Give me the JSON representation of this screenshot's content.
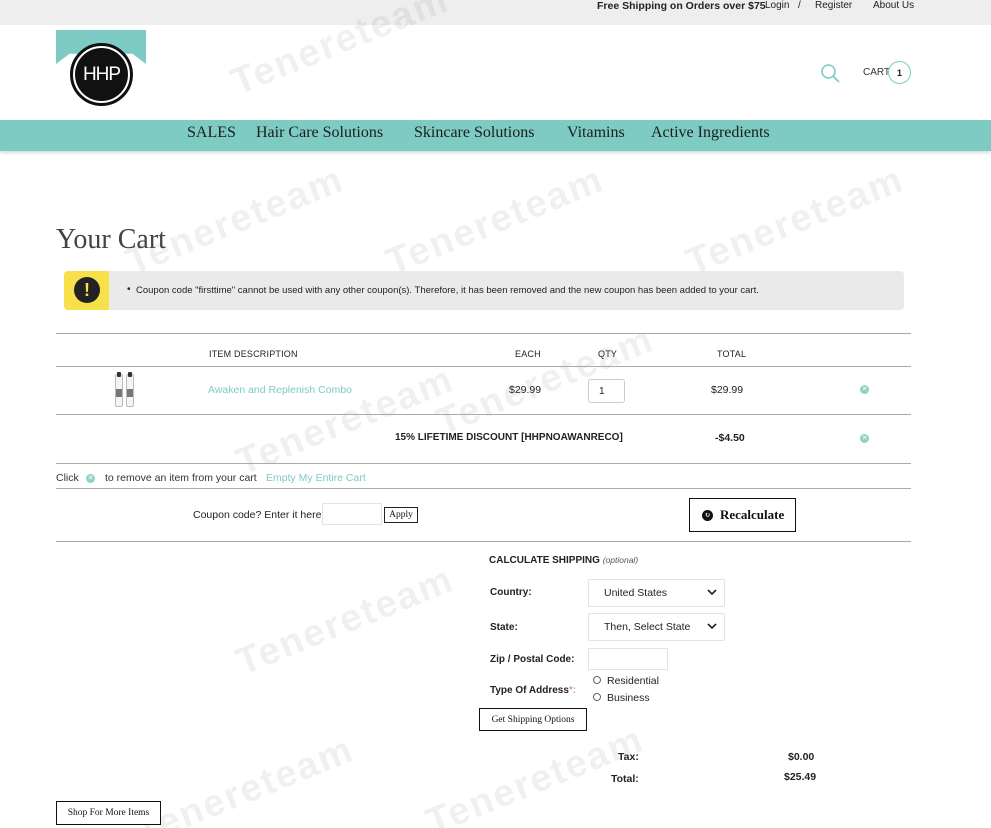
{
  "topbar": {
    "promo": "Free Shipping on Orders over $75",
    "login": "Login",
    "separator": "/",
    "register": "Register",
    "about": "About Us"
  },
  "logo": {
    "text": "HHP"
  },
  "header": {
    "cart_label": "CART",
    "cart_count": "1"
  },
  "nav": {
    "items": [
      {
        "label": "SALES"
      },
      {
        "label": "Hair Care Solutions"
      },
      {
        "label": "Skincare Solutions"
      },
      {
        "label": "Vitamins"
      },
      {
        "label": "Active Ingredients"
      }
    ]
  },
  "page": {
    "title": "Your Cart"
  },
  "alert": {
    "message": "Coupon code \"firsttime\" cannot be used with any other coupon(s). Therefore, it has been removed and the new coupon has been added to your cart."
  },
  "cart": {
    "headers": {
      "description": "ITEM DESCRIPTION",
      "each": "EACH",
      "qty": "QTY",
      "total": "TOTAL"
    },
    "items": [
      {
        "name": "Awaken and Replenish Combo",
        "each": "$29.99",
        "qty": "1",
        "total": "$29.99"
      }
    ],
    "discount": {
      "label": "15% LIFETIME DISCOUNT [HHPNOAWANRECO]",
      "value": "-$4.50"
    },
    "remove_hint": {
      "before": "Click",
      "after": "to remove an item from your cart"
    },
    "empty_link": "Empty My Entire Cart",
    "coupon_label": "Coupon code? Enter it here:",
    "apply_label": "Apply",
    "recalculate_label": "Recalculate"
  },
  "shipping": {
    "heading": "CALCULATE SHIPPING",
    "optional": "(optional)",
    "country_label": "Country:",
    "country_value": "United States",
    "state_label": "State:",
    "state_value": "Then, Select State",
    "zip_label": "Zip / Postal Code:",
    "address_type_label": "Type Of Address",
    "required_mark": "*:",
    "options": [
      "Residential",
      "Business"
    ],
    "button_label": "Get Shipping Options"
  },
  "summary": {
    "tax_label": "Tax:",
    "tax_value": "$0.00",
    "total_label": "Total:",
    "total_value": "$25.49"
  },
  "footer": {
    "shop_more_label": "Shop For More Items"
  },
  "watermark": {
    "text": "Tenereteam"
  },
  "colors": {
    "teal": "#7dcbc3",
    "alert_yellow": "#f8e04a",
    "topbar_gray": "#eeeeee"
  }
}
